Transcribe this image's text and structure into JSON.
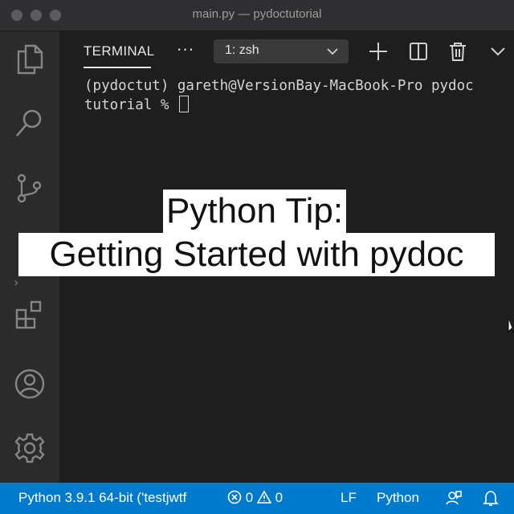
{
  "window": {
    "title": "main.py — pydoctutorial"
  },
  "activity_bar": {
    "icons": [
      "explorer-icon",
      "search-icon",
      "source-control-icon",
      "run-debug-icon",
      "extensions-icon",
      "account-icon",
      "settings-gear-icon"
    ]
  },
  "panel": {
    "tab_label": "TERMINAL",
    "more_label": "···",
    "terminal_selector": {
      "value": "1: zsh"
    }
  },
  "terminal": {
    "line1": "(pydoctut) gareth@VersionBay-MacBook-Pro pydoc",
    "line2": "tutorial % "
  },
  "overlay": {
    "line1": "Python Tip:",
    "line2": "Getting Started with pydoc"
  },
  "status_bar": {
    "interpreter": "Python 3.9.1 64-bit ('testjwtf",
    "errors": "0",
    "warnings": "0",
    "eol": "LF",
    "language": "Python"
  },
  "colors": {
    "status_bar_bg": "#007acc",
    "editor_bg": "#1e1e1e",
    "activity_bar_bg": "#2b2b2b",
    "titlebar_bg": "#2f2f31"
  }
}
